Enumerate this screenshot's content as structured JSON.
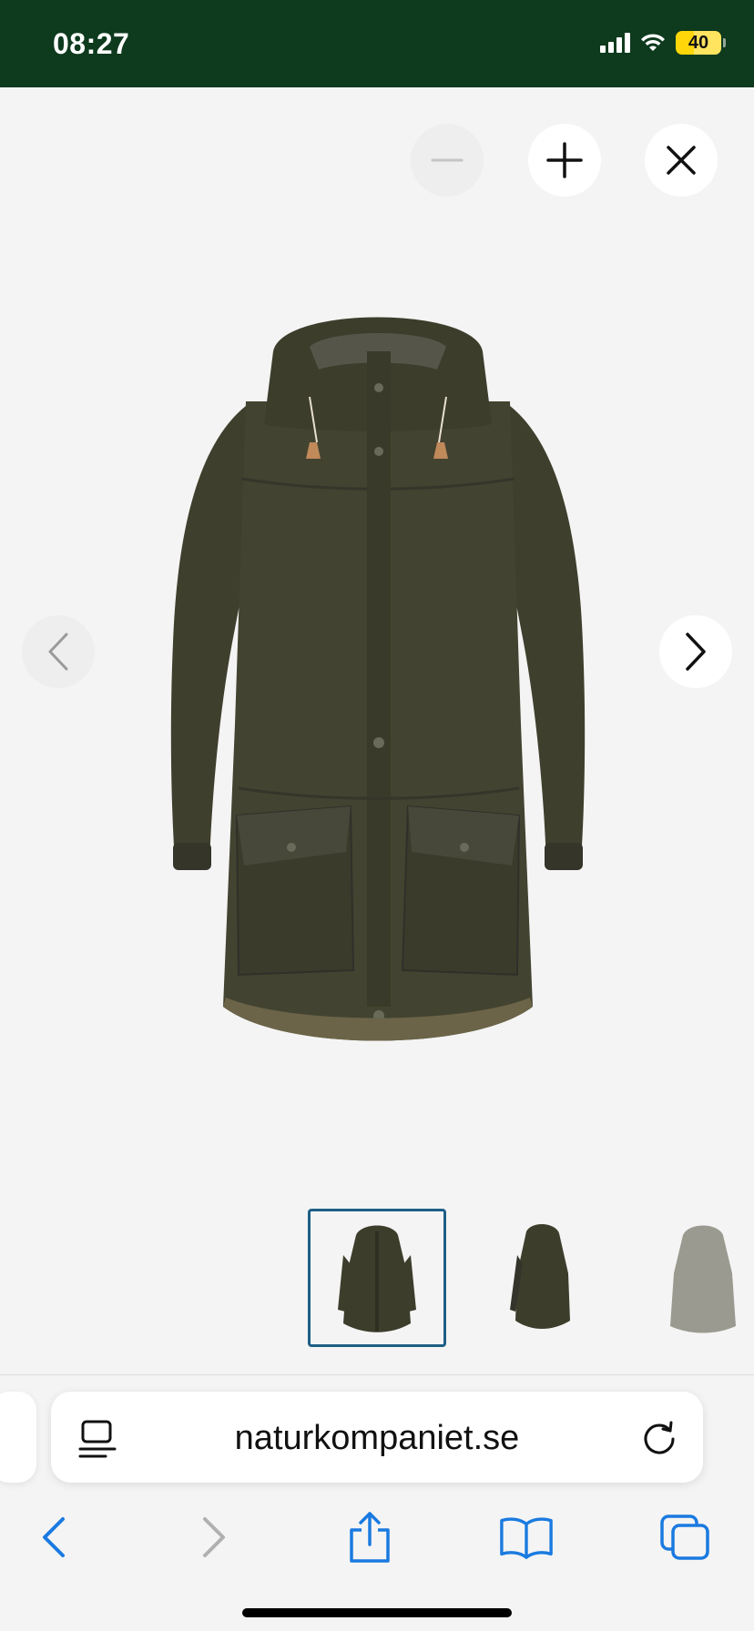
{
  "status_bar": {
    "time": "08:27",
    "battery_level": "40",
    "background_color": "#0e3a1e",
    "icons": [
      "signal-icon",
      "wifi-icon",
      "battery-icon"
    ]
  },
  "gallery": {
    "controls": [
      "zoom-out-icon",
      "zoom-in-icon",
      "close-icon",
      "chevron-left-icon",
      "chevron-right-icon"
    ],
    "product_image": "dark olive green parka jacket with hood",
    "selected_thumbnail_index": 0,
    "thumbnails": [
      {
        "color": "#3d3d2c"
      },
      {
        "color": "#3d3d2c"
      },
      {
        "color": "#9a9a90"
      }
    ],
    "accent_color": "#1e5f86"
  },
  "browser": {
    "url": "naturkompaniet.se",
    "toolbar": [
      "back-icon",
      "forward-icon",
      "share-icon",
      "bookmarks-icon",
      "tabs-icon"
    ],
    "link_color": "#1a7ae0"
  }
}
